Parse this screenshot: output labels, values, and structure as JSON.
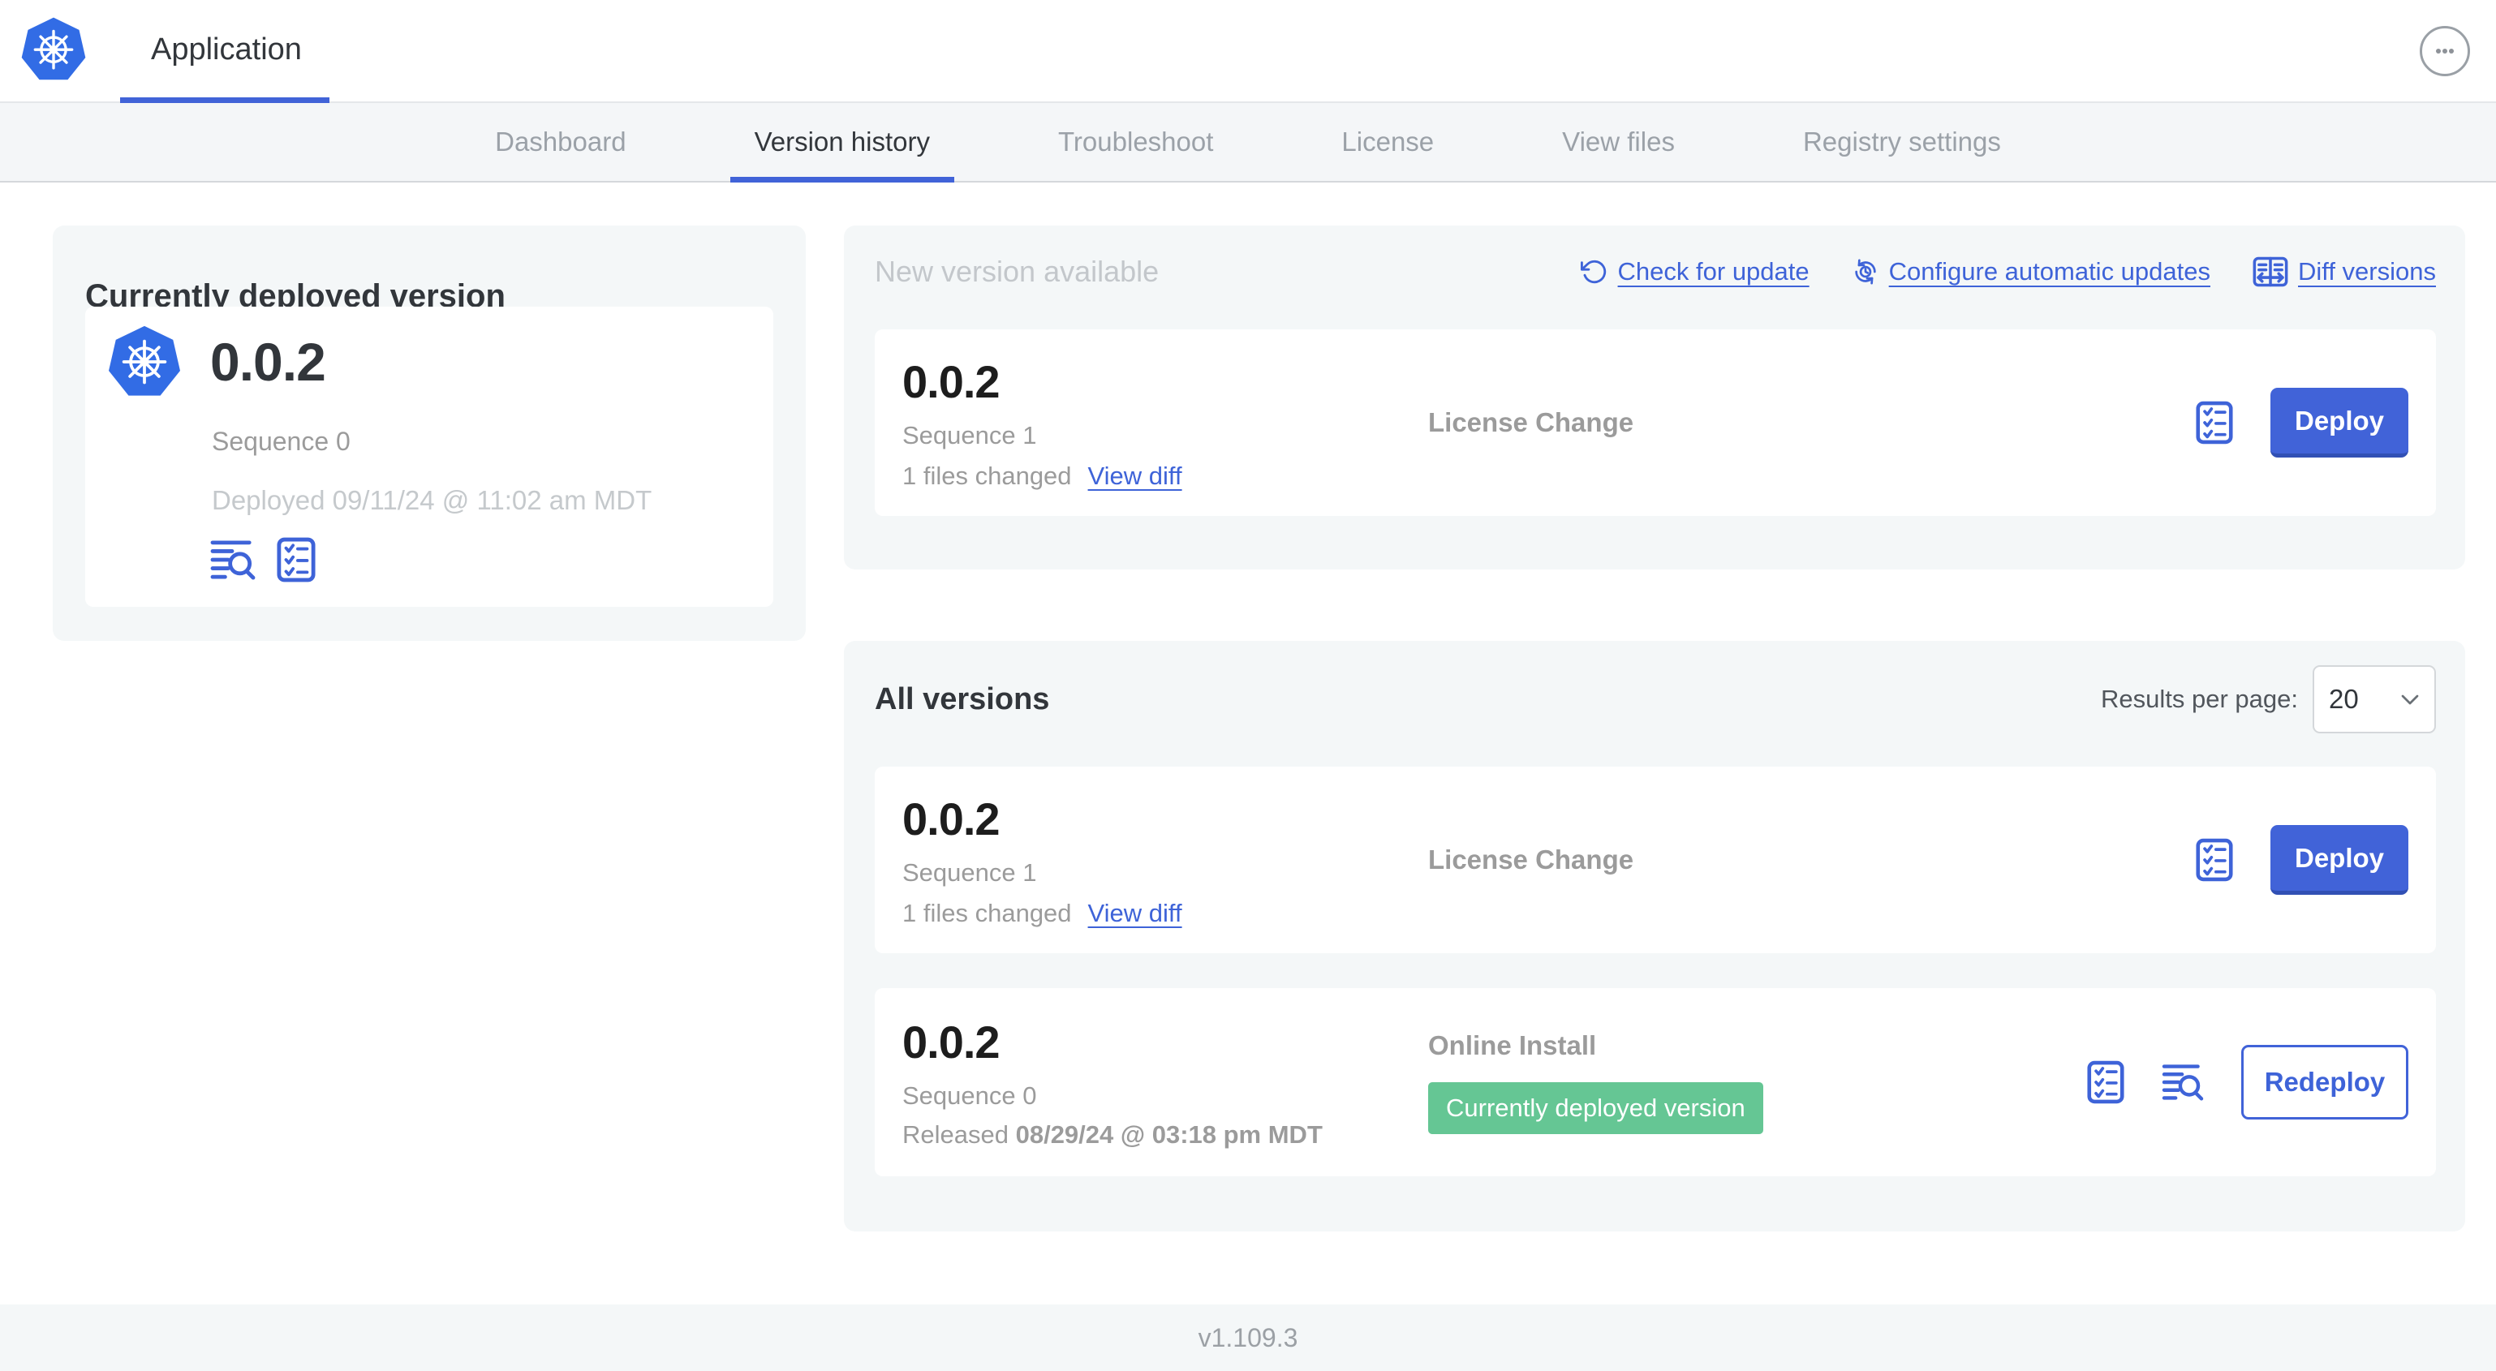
{
  "colors": {
    "accent_blue": "#4163D8",
    "link_blue": "#3E63D8",
    "kubernetes_blue": "#326CE5",
    "badge_green": "#65C694",
    "card_gray": "#f4f7f8"
  },
  "header": {
    "app_title": "Application"
  },
  "tabs": [
    {
      "label": "Dashboard"
    },
    {
      "label": "Version history"
    },
    {
      "label": "Troubleshoot"
    },
    {
      "label": "License"
    },
    {
      "label": "View files"
    },
    {
      "label": "Registry settings"
    }
  ],
  "active_tab": "Version history",
  "currently_deployed": {
    "title": "Currently deployed version",
    "version": "0.0.2",
    "sequence": "Sequence 0",
    "deployed_timestamp": "Deployed 09/11/24 @ 11:02 am MDT"
  },
  "new_version": {
    "title": "New version available",
    "check_for_update": "Check for update",
    "configure_automatic_updates": "Configure automatic updates",
    "diff_versions": "Diff versions",
    "row": {
      "version": "0.0.2",
      "sequence": "Sequence 1",
      "files_changed": "1 files changed",
      "view_diff": "View diff",
      "source": "License Change",
      "deploy": "Deploy"
    }
  },
  "all_versions": {
    "title": "All versions",
    "results_per_page_label": "Results per page:",
    "results_per_page_value": "20",
    "rows": [
      {
        "version": "0.0.2",
        "sequence": "Sequence 1",
        "files_changed": "1 files changed",
        "view_diff": "View diff",
        "source": "License Change",
        "action": "Deploy"
      },
      {
        "version": "0.0.2",
        "sequence": "Sequence 0",
        "released_prefix": "Released ",
        "released_date": "08/29/24 @ 03:18 pm MDT",
        "source": "Online Install",
        "badge": "Currently deployed version",
        "action": "Redeploy"
      }
    ]
  },
  "footer": {
    "version": "v1.109.3"
  }
}
